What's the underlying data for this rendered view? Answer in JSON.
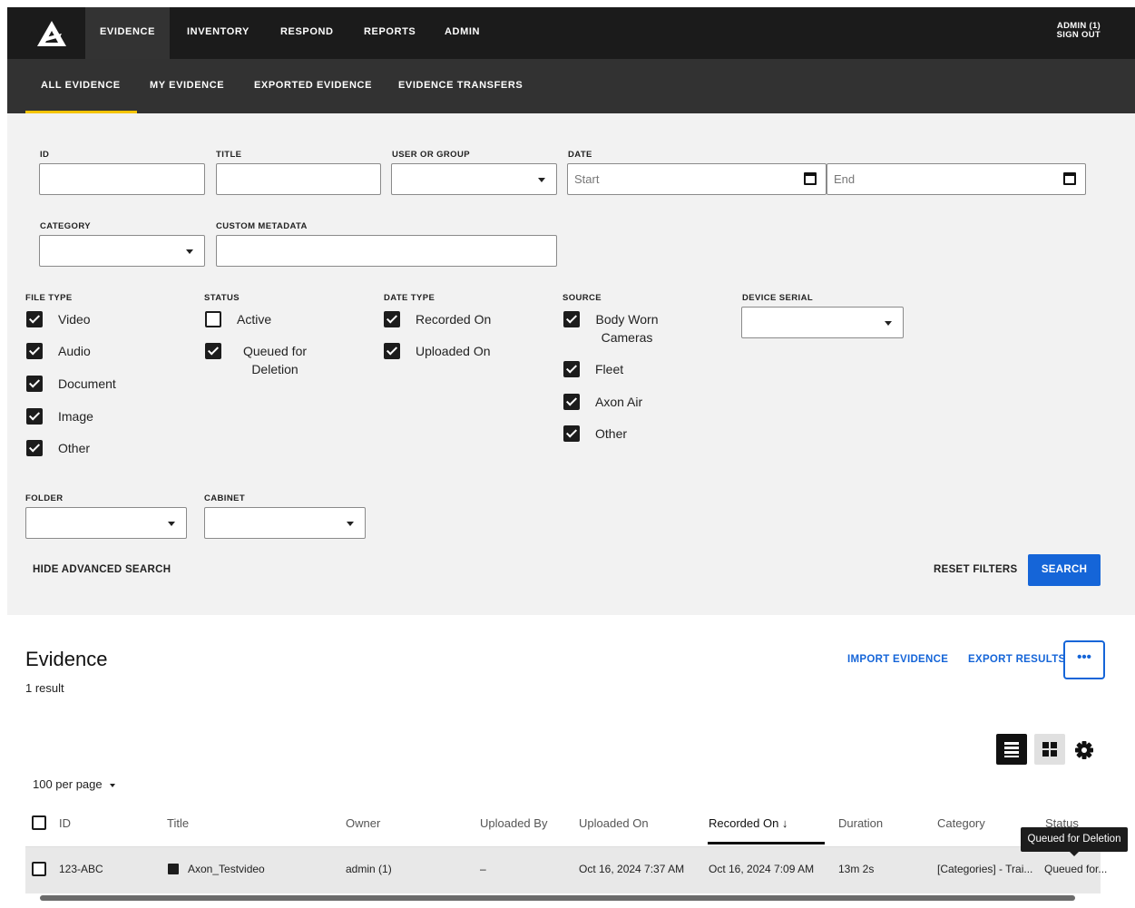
{
  "topnav": {
    "items": [
      {
        "label": "EVIDENCE"
      },
      {
        "label": "INVENTORY"
      },
      {
        "label": "RESPOND"
      },
      {
        "label": "REPORTS"
      },
      {
        "label": "ADMIN"
      }
    ],
    "user": "ADMIN (1)",
    "sign_out": "SIGN OUT"
  },
  "subnav": {
    "items": [
      {
        "label": "ALL EVIDENCE"
      },
      {
        "label": "MY EVIDENCE"
      },
      {
        "label": "EXPORTED EVIDENCE"
      },
      {
        "label": "EVIDENCE TRANSFERS"
      }
    ]
  },
  "filters": {
    "id_label": "ID",
    "title_label": "TITLE",
    "user_group_label": "USER OR GROUP",
    "date_label": "DATE",
    "date_start_placeholder": "Start",
    "date_end_placeholder": "End",
    "category_label": "CATEGORY",
    "custom_metadata_label": "CUSTOM METADATA",
    "file_type_label": "FILE TYPE",
    "file_types": [
      {
        "label": "Video",
        "checked": true
      },
      {
        "label": "Audio",
        "checked": true
      },
      {
        "label": "Document",
        "checked": true
      },
      {
        "label": "Image",
        "checked": true
      },
      {
        "label": "Other",
        "checked": true
      }
    ],
    "status_label": "STATUS",
    "statuses": [
      {
        "label": "Active",
        "checked": false
      },
      {
        "label": "Queued for Deletion",
        "checked": true
      }
    ],
    "date_type_label": "DATE TYPE",
    "date_types": [
      {
        "label": "Recorded On",
        "checked": true
      },
      {
        "label": "Uploaded On",
        "checked": true
      }
    ],
    "source_label": "SOURCE",
    "sources": [
      {
        "label": "Body Worn Cameras",
        "checked": true
      },
      {
        "label": "Fleet",
        "checked": true
      },
      {
        "label": "Axon Air",
        "checked": true
      },
      {
        "label": "Other",
        "checked": true
      }
    ],
    "device_serial_label": "DEVICE SERIAL",
    "folder_label": "FOLDER",
    "cabinet_label": "CABINET",
    "hide_advanced": "HIDE ADVANCED SEARCH",
    "reset": "RESET FILTERS",
    "search": "SEARCH"
  },
  "evidence": {
    "title": "Evidence",
    "count": "1 result",
    "import": "IMPORT EVIDENCE",
    "export": "EXPORT RESULTS",
    "more": "•••",
    "per_page": "100 per page",
    "columns": [
      "ID",
      "Title",
      "Owner",
      "Uploaded By",
      "Uploaded On",
      "Recorded On ↓",
      "Duration",
      "Category",
      "Status"
    ],
    "rows": [
      {
        "id": "123-ABC",
        "title": "Axon_Testvideo",
        "owner": "admin (1)",
        "uploaded_by": "–",
        "uploaded_on": "Oct 16, 2024 7:37 AM",
        "recorded_on": "Oct 16, 2024 7:09 AM",
        "duration": "13m 2s",
        "category": "[Categories] - Trai...",
        "status": "Queued for..."
      }
    ],
    "tooltip": "Queued for Deletion"
  },
  "colors": {
    "accent": "#1565d8",
    "tab_indicator": "#f5c400",
    "topbar": "#1b1b1b",
    "subbar": "#323232"
  }
}
